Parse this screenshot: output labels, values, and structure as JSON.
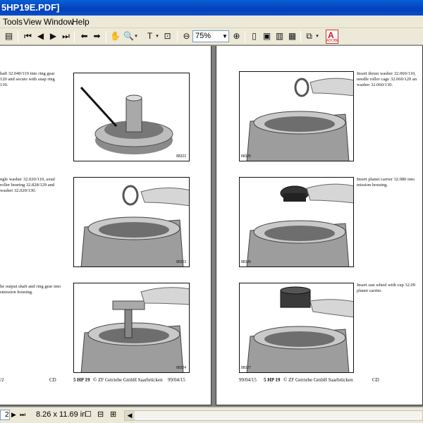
{
  "window": {
    "title": "5HP19E.PDF]"
  },
  "menu": {
    "items": [
      "Tools",
      "View",
      "Window",
      "Help"
    ]
  },
  "toolbar": {
    "zoom_value": "75%",
    "adobe_label": "ADOBE"
  },
  "left_page": {
    "steps": [
      {
        "caption": "haft 32.040/119 into ring gear\n120 and secure with snap ring\n130.",
        "figure": "88322"
      },
      {
        "caption": "ngle washer 32.020/110, axial\nroller bearing 32.828/129 and\nwasher 32.020/130.",
        "figure": "88323"
      },
      {
        "caption": "he output shaft and ring gear into\nsmission housing.",
        "figure": "88324"
      }
    ],
    "footer_left": "/2",
    "footer_cd": "CD",
    "footer_title": "5 HP 19",
    "footer_copyright": "© ZF Getriebe GmbH Saarbrücken",
    "footer_date": "99/04/15"
  },
  "right_page": {
    "steps": [
      {
        "caption": "Insert thrust washer 32.060/110,\nneedle roller cage 32.060/120 an\nwasher 32.060/130.",
        "figure": "88325"
      },
      {
        "caption": "Insert planet carrier 32.080 into\nmission housing.",
        "figure": "88326"
      },
      {
        "caption": "Insert sun wheel with cup 32.09\nplanet carrier.",
        "figure": "88327"
      }
    ],
    "footer_date": "99/04/15",
    "footer_title": "5 HP 19",
    "footer_copyright": "© ZF Getriebe GmbH Saarbrücken",
    "footer_cd": "CD"
  },
  "statusbar": {
    "page_fragment": "2",
    "page_size": "8.26 x 11.69 in"
  }
}
